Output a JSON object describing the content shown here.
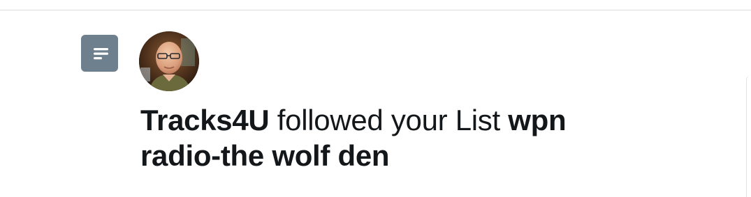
{
  "notification": {
    "user_name": "Tracks4U",
    "action_text": " followed your List ",
    "list_name": "wpn radio-the wolf den",
    "type_icon": "list-icon",
    "avatar_alt": "Tracks4U avatar"
  },
  "colors": {
    "badge_background": "#6e7f8d",
    "text": "#14171a",
    "divider": "#dcdcdc"
  }
}
